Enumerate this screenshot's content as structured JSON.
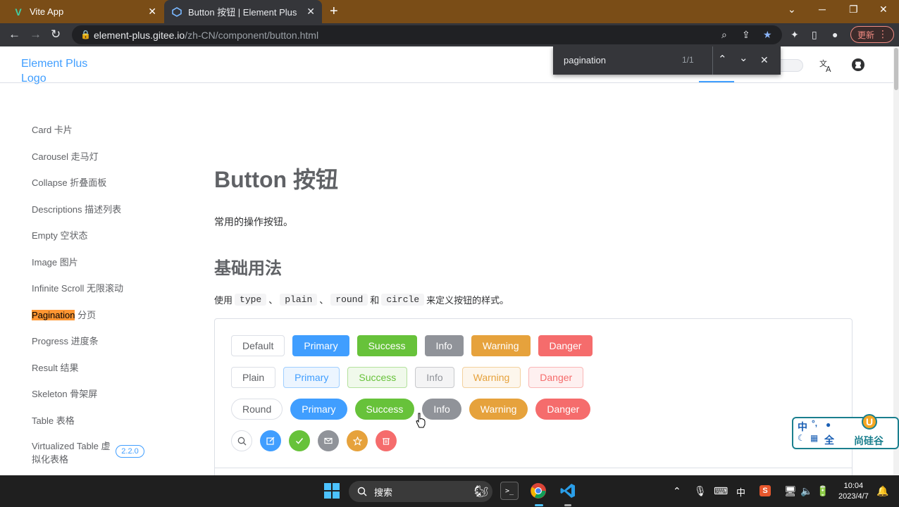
{
  "browser": {
    "tabs": [
      {
        "title": "Vite App",
        "favicon": "V",
        "active": false
      },
      {
        "title": "Button 按钮 | Element Plus",
        "favicon": "element-plus-icon",
        "active": true
      }
    ],
    "url_host": "element-plus.gitee.io",
    "url_path": "/zh-CN/component/button.html",
    "update_label": "更新"
  },
  "find_bar": {
    "query": "pagination",
    "count": "1/1"
  },
  "header": {
    "logo_alt": "Element Plus Logo"
  },
  "sidebar": {
    "items": [
      {
        "label": "Card 卡片"
      },
      {
        "label": "Carousel 走马灯"
      },
      {
        "label": "Collapse 折叠面板"
      },
      {
        "label": "Descriptions 描述列表"
      },
      {
        "label": "Empty 空状态"
      },
      {
        "label": "Image 图片"
      },
      {
        "label": "Infinite Scroll 无限滚动"
      },
      {
        "label_highlight": "Pagination",
        "label_rest": " 分页"
      },
      {
        "label": "Progress 进度条"
      },
      {
        "label": "Result 结果"
      },
      {
        "label": "Skeleton 骨架屏"
      },
      {
        "label": "Table 表格"
      },
      {
        "label_line1": "Virtualized Table 虚",
        "label_line2": "拟化表格",
        "badge": "2.2.0"
      }
    ]
  },
  "main": {
    "title": "Button 按钮",
    "lead": "常用的操作按钮。",
    "section_title": "基础用法",
    "desc_prefix": "使用",
    "desc_codes": [
      "type",
      "plain",
      "round",
      "circle"
    ],
    "desc_sep": "、",
    "desc_and": "和",
    "desc_suffix": "来定义按钮的样式。"
  },
  "demo": {
    "row1": [
      "Default",
      "Primary",
      "Success",
      "Info",
      "Warning",
      "Danger"
    ],
    "row2": [
      "Plain",
      "Primary",
      "Success",
      "Info",
      "Warning",
      "Danger"
    ],
    "row3": [
      "Round",
      "Primary",
      "Success",
      "Info",
      "Warning",
      "Danger"
    ],
    "row4_icons": [
      "search-icon",
      "edit-icon",
      "check-icon",
      "message-icon",
      "star-icon",
      "delete-icon"
    ]
  },
  "ime": {
    "chars": [
      "中",
      "°,",
      "全"
    ],
    "brand": "尚硅谷"
  },
  "taskbar": {
    "search_label": "搜索",
    "ime_mode": "中",
    "time": "10:04",
    "date": "2023/4/7"
  }
}
